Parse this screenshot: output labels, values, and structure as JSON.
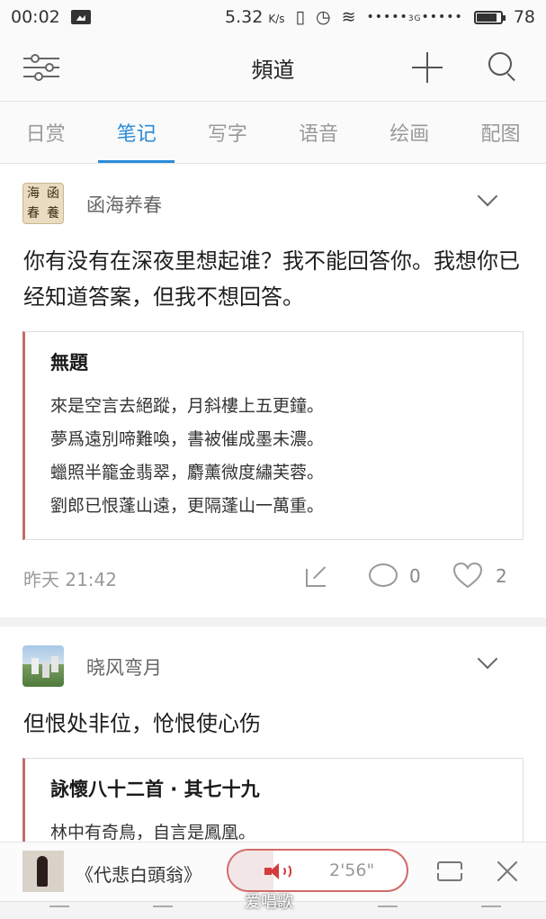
{
  "status_bar": {
    "time": "00:02",
    "speed_value": "5.32",
    "speed_unit": "K/s",
    "network_tag": "3G",
    "battery": "78"
  },
  "header": {
    "title": "頻道"
  },
  "tabs": [
    {
      "label": "日赏",
      "active": false
    },
    {
      "label": "笔记",
      "active": true
    },
    {
      "label": "写字",
      "active": false
    },
    {
      "label": "语音",
      "active": false
    },
    {
      "label": "绘画",
      "active": false
    },
    {
      "label": "配图",
      "active": false
    }
  ],
  "posts": [
    {
      "author": "函海养春",
      "avatar_text": [
        "海",
        "函",
        "春",
        "養"
      ],
      "text": "你有没有在深夜里想起谁？我不能回答你。我想你已经知道答案，但我不想回答。",
      "poem": {
        "title": "無題",
        "lines": [
          "來是空言去絕蹤，月斜樓上五更鐘。",
          "夢爲遠別啼難喚，書被催成墨未濃。",
          "蠟照半籠金翡翠，麝薰微度繡芙蓉。",
          "劉郎已恨蓬山遠，更隔蓬山一萬重。"
        ]
      },
      "time": "昨天 21:42",
      "comments": "0",
      "likes": "2"
    },
    {
      "author": "晓风弯月",
      "text": "但恨处非位，怆恨使心伤",
      "poem": {
        "title": "詠懷八十二首 · 其七十九",
        "lines": [
          "林中有奇鳥，自言是鳳凰。"
        ]
      }
    }
  ],
  "player": {
    "title": "《代悲白頭翁》",
    "duration": "2'56\"",
    "progress": 0.25
  },
  "watermark": "爱唱歌",
  "colors": {
    "accent": "#2a8bd8",
    "player_border": "#d46a6a",
    "speaker": "#d43b3b"
  }
}
